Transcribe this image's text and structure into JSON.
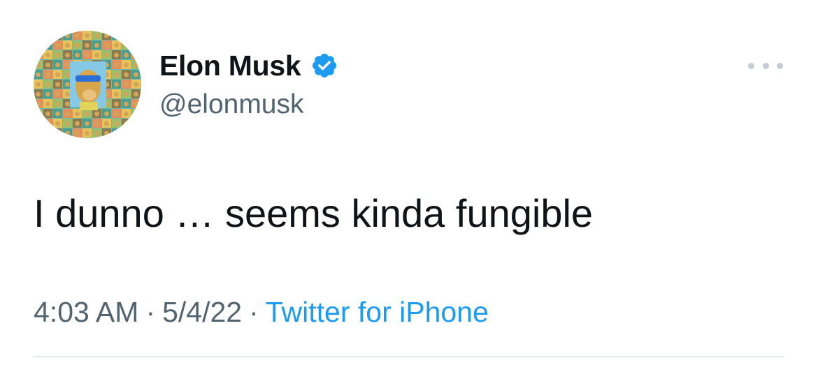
{
  "author": {
    "display_name": "Elon Musk",
    "handle": "@elonmusk",
    "verified": true,
    "avatar_icon": "nft-ape-avatar-icon"
  },
  "tweet": {
    "text": "I dunno … seems kinda fungible"
  },
  "meta": {
    "time": "4:03 AM",
    "separator": "·",
    "date": "5/4/22",
    "source": "Twitter for iPhone"
  },
  "colors": {
    "primary_text": "#0f1419",
    "secondary_text": "#536471",
    "link": "#1d9bf0",
    "verified_badge": "#1d9bf0",
    "more_dots": "#c5ccd3",
    "divider": "#e3e7ea"
  },
  "icons": {
    "more": "more-options-icon",
    "verified": "verified-badge-icon"
  }
}
